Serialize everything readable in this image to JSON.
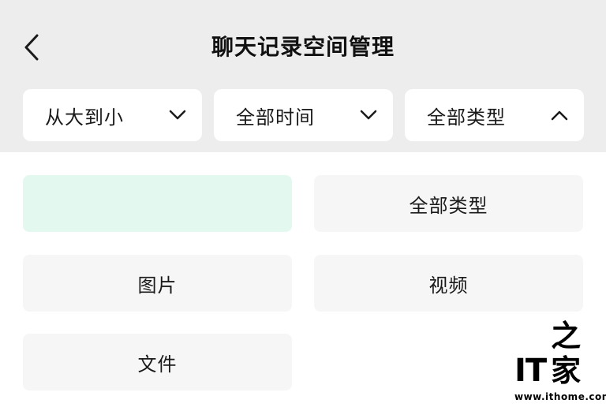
{
  "header": {
    "title": "聊天记录空间管理",
    "back_icon": "chevron-left-icon"
  },
  "filters": [
    {
      "label": "从大到小",
      "icon": "chevron-down-icon",
      "expanded": false
    },
    {
      "label": "全部时间",
      "icon": "chevron-down-icon",
      "expanded": false
    },
    {
      "label": "全部类型",
      "icon": "chevron-up-icon",
      "expanded": true
    }
  ],
  "type_options": [
    {
      "label": "",
      "selected": true
    },
    {
      "label": "全部类型",
      "selected": false
    },
    {
      "label": "图片",
      "selected": false
    },
    {
      "label": "视频",
      "selected": false
    },
    {
      "label": "文件",
      "selected": false
    }
  ],
  "watermark": {
    "logo_text": "IT",
    "logo_text_cn": "之家",
    "url": "www.ithome.com"
  },
  "colors": {
    "header_bg": "#ededed",
    "card_bg": "#ffffff",
    "option_bg": "#f6f6f6",
    "selected_bg": "#e3f8ee"
  }
}
